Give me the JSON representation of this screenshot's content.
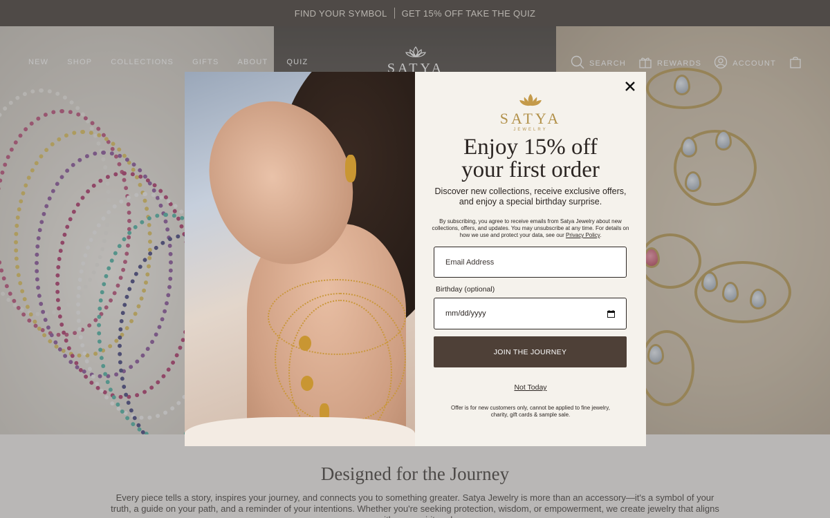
{
  "announcement": {
    "left": "FIND YOUR SYMBOL",
    "right": "GET 15% OFF TAKE THE QUIZ"
  },
  "nav": {
    "links": [
      "NEW",
      "SHOP",
      "COLLECTIONS",
      "GIFTS",
      "ABOUT",
      "QUIZ"
    ],
    "logo": "SATYA",
    "search": "SEARCH",
    "rewards": "REWARDS",
    "account": "ACCOUNT"
  },
  "icons": {
    "search": "search-icon",
    "rewards": "gift-icon",
    "account": "user-icon",
    "cart": "bag-icon",
    "close": "close-icon",
    "calendar": "calendar-icon",
    "brand": "lotus-icon"
  },
  "modal": {
    "brand_name": "SATYA",
    "brand_sub": "JEWELRY",
    "headline_line1": "Enjoy 15% off",
    "headline_line2": "your first order",
    "lead_line1": "Discover new collections, receive exclusive offers,",
    "lead_line2": "and enjoy a special birthday surprise.",
    "legal_text": "By subscribing, you agree to receive emails from Satya Jewelry about new collections, offers, and updates. You may unsubscribe at any time. For details on how we use and protect your data, see our",
    "legal_link": "Privacy Policy",
    "email_placeholder": "Email Address",
    "birthday_label": "Birthday (optional)",
    "birthday_placeholder": "mm/dd/yyyy",
    "join_label": "JOIN THE JOURNEY",
    "not_today": "Not Today",
    "fine_print": "Offer is for new customers only, cannot be applied to fine jewelry, charity, gift cards & sample sale."
  },
  "section": {
    "title": "Designed for the Journey",
    "body": "Every piece tells a story, inspires your journey, and connects you to something greater. Satya Jewelry is more than an accessory—it's a symbol of your truth, a guide on your path, and a reminder of your intentions. Whether you're seeking protection, wisdom, or empowerment, we create jewelry that aligns with your spirit and"
  },
  "colors": {
    "announcement_bg": "#2e2620",
    "button_bg": "#4e4037",
    "brand_gold": "#b2914a",
    "modal_bg": "#f5f2ec"
  }
}
